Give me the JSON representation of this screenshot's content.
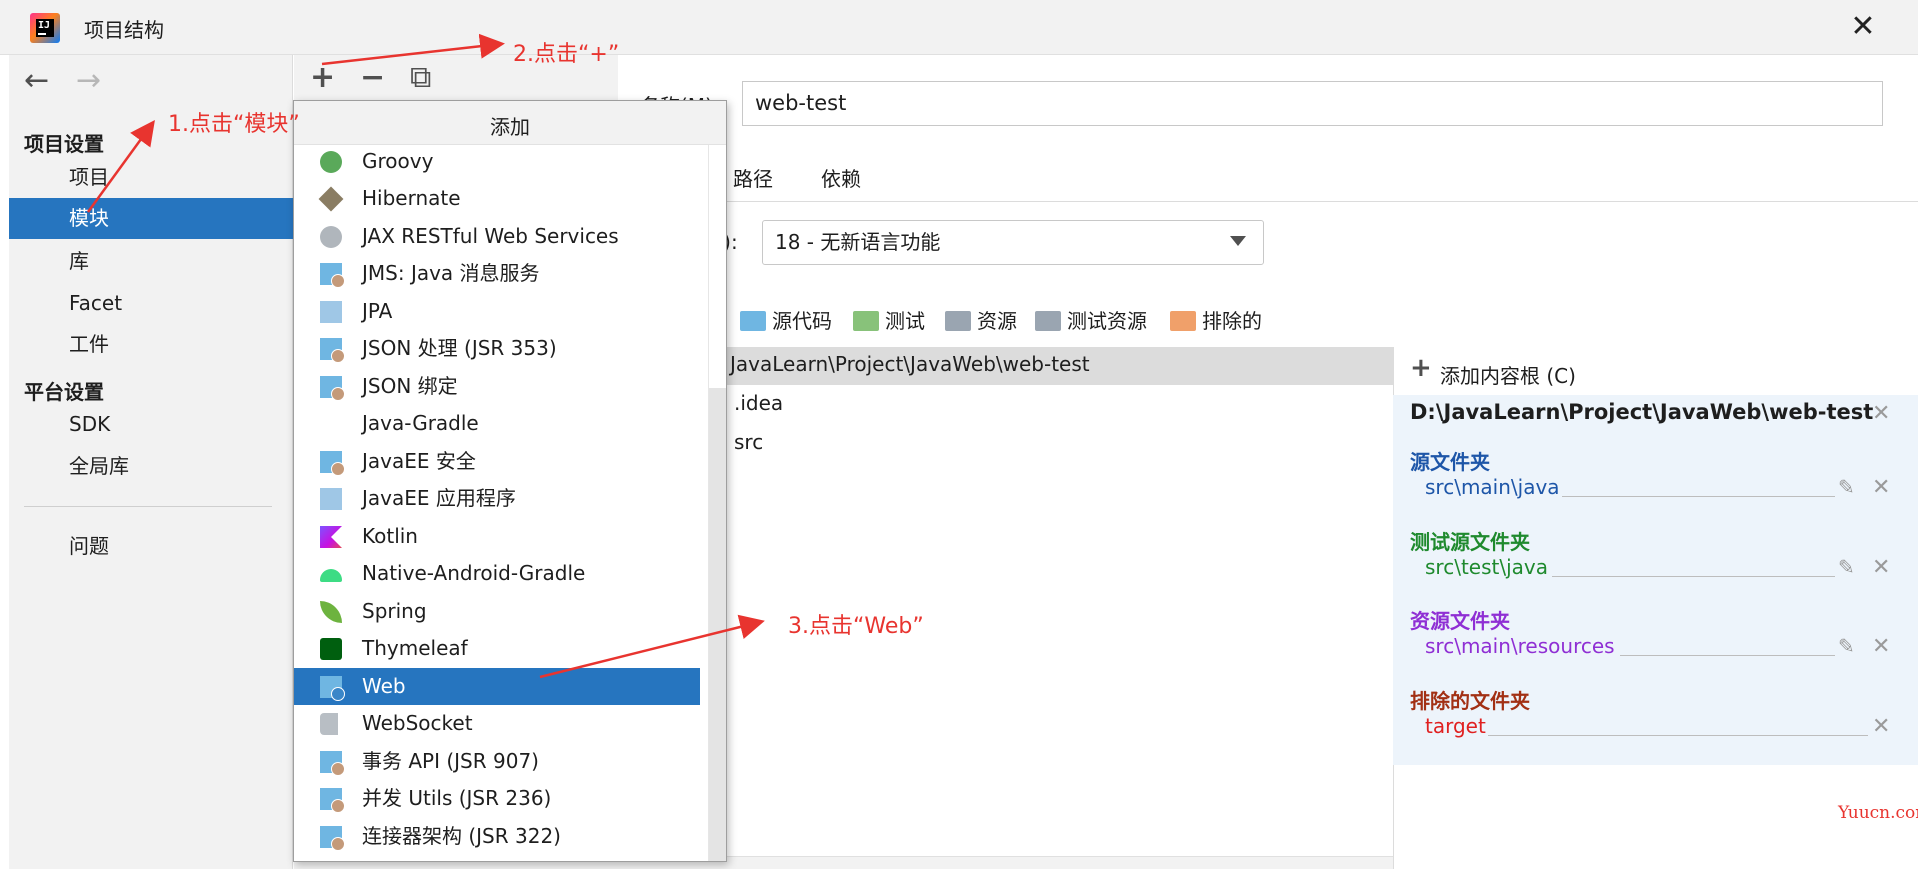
{
  "window": {
    "title": "项目结构",
    "close": "✕"
  },
  "nav": {
    "back": "←",
    "forward": "→"
  },
  "sidebar": {
    "project_settings": "项目设置",
    "items1": [
      {
        "label": "项目"
      },
      {
        "label": "模块",
        "selected": true
      },
      {
        "label": "库"
      },
      {
        "label": "Facet"
      },
      {
        "label": "工件"
      }
    ],
    "platform_settings": "平台设置",
    "items2": [
      {
        "label": "SDK"
      },
      {
        "label": "全局库"
      }
    ],
    "problems": "问题"
  },
  "toolbar": {
    "add": "+",
    "remove": "−",
    "copy": "⧉"
  },
  "main": {
    "name_label": "名称(M):",
    "name_value": "web-test",
    "tabs": [
      "路径",
      "依赖"
    ],
    "lang_label": "L):",
    "lang_value": "18 - 无新语言功能",
    "folder_buttons": [
      {
        "label": "源代码",
        "color": "#6fb6e2"
      },
      {
        "label": "测试",
        "color": "#88c27a"
      },
      {
        "label": "资源",
        "color": "#9aa5b1"
      },
      {
        "label": "测试资源",
        "color": "#9aa5b1"
      },
      {
        "label": "排除的",
        "color": "#f0a06a"
      }
    ],
    "tree_root": "JavaLearn\\Project\\JavaWeb\\web-test",
    "tree_items": [
      ".idea",
      "src"
    ]
  },
  "roots": {
    "add_label": "添加内容根 (C)",
    "path": "D:\\JavaLearn\\Project\\JavaWeb\\web-test",
    "source_head": "源文件夹",
    "source_val": "src\\main\\java",
    "test_head": "测试源文件夹",
    "test_val": "src\\test\\java",
    "res_head": "资源文件夹",
    "res_val": "src\\main\\resources",
    "excl_head": "排除的文件夹",
    "excl_val": "target",
    "x": "✕",
    "pencil": "✎",
    "colors": {
      "source": "#1e56a8",
      "test": "#1f8a2e",
      "resource": "#8f2fd4",
      "excluded": "#a23014",
      "excluded_val": "#e02020"
    }
  },
  "popup": {
    "title": "添加",
    "items": [
      {
        "label": "Groovy",
        "icon": "groovy-icon"
      },
      {
        "label": "Hibernate",
        "icon": "hibernate-icon"
      },
      {
        "label": "JAX RESTful Web Services",
        "icon": "web-services-icon"
      },
      {
        "label": "JMS: Java 消息服务",
        "icon": "module-icon"
      },
      {
        "label": "JPA",
        "icon": "jpa-icon"
      },
      {
        "label": "JSON 处理 (JSR 353)",
        "icon": "module-icon"
      },
      {
        "label": "JSON 绑定",
        "icon": "module-icon"
      },
      {
        "label": "Java-Gradle",
        "icon": ""
      },
      {
        "label": "JavaEE 安全",
        "icon": "module-icon"
      },
      {
        "label": "JavaEE 应用程序",
        "icon": "javaee-app-icon"
      },
      {
        "label": "Kotlin",
        "icon": "kotlin-icon"
      },
      {
        "label": "Native-Android-Gradle",
        "icon": "android-icon"
      },
      {
        "label": "Spring",
        "icon": "spring-icon"
      },
      {
        "label": "Thymeleaf",
        "icon": "thymeleaf-icon"
      },
      {
        "label": "Web",
        "icon": "web-icon",
        "selected": true
      },
      {
        "label": "WebSocket",
        "icon": "websocket-icon"
      },
      {
        "label": "事务 API (JSR 907)",
        "icon": "module-icon"
      },
      {
        "label": "并发 Utils (JSR 236)",
        "icon": "module-icon"
      },
      {
        "label": "连接器架构 (JSR 322)",
        "icon": "module-icon"
      }
    ]
  },
  "annotations": {
    "step1": "1.点击“模块”",
    "step2": "2.点击“+”",
    "step3": "3.点击“Web”",
    "color": "#e8342f"
  },
  "watermark": "Yuucn.com"
}
